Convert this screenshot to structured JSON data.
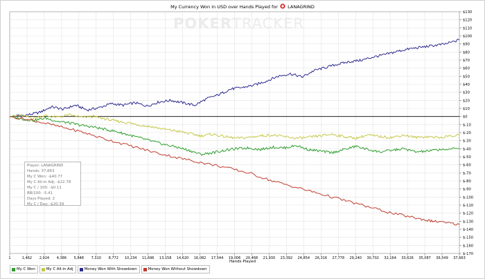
{
  "chart_data": {
    "type": "line",
    "title_prefix": "My Currency Won in USD over Hands Played for",
    "title_player": "LANAGRIND",
    "xlabel": "Hands Played",
    "x_ticks": [
      "1",
      "1,462",
      "2,924",
      "4,386",
      "5,848",
      "7,310",
      "8,772",
      "10,234",
      "11,696",
      "13,158",
      "14,620",
      "16,082",
      "17,544",
      "19,006",
      "20,468",
      "21,930",
      "23,392",
      "24,854",
      "26,316",
      "27,778",
      "29,240",
      "30,702",
      "32,164",
      "33,626",
      "35,087",
      "36,549",
      "37,663"
    ],
    "xlim": [
      1,
      37663
    ],
    "ylim": [
      -170,
      130
    ],
    "y_tick_step": 10,
    "y_tick_labels": [
      "$130",
      "$120",
      "$110",
      "$100",
      "$90",
      "$80",
      "$70",
      "$60",
      "$50",
      "$40",
      "$30",
      "$20",
      "$10",
      "$0",
      "$-10",
      "$-20",
      "$-30",
      "$-40",
      "$-50",
      "$-60",
      "$-70",
      "$-80",
      "$-90",
      "$-100",
      "$-110",
      "$-120",
      "$-130",
      "$-140",
      "$-150",
      "$-160",
      "$-170"
    ],
    "series": [
      {
        "name": "Money Won With Showdown",
        "color": "#2b2b8f",
        "x": [
          1,
          1500,
          2500,
          3500,
          4500,
          5500,
          6500,
          7500,
          8500,
          9500,
          10500,
          11500,
          12500,
          13500,
          14500,
          15500,
          16500,
          17500,
          18500,
          19500,
          20500,
          21500,
          22500,
          23500,
          24500,
          25500,
          26500,
          27500,
          28500,
          29500,
          30500,
          31500,
          32500,
          33500,
          34500,
          35500,
          36500,
          37663
        ],
        "y": [
          0,
          2,
          5,
          12,
          9,
          14,
          8,
          11,
          16,
          14,
          17,
          13,
          18,
          20,
          17,
          14,
          22,
          27,
          34,
          36,
          39,
          44,
          50,
          53,
          49,
          57,
          61,
          65,
          68,
          70,
          74,
          77,
          81,
          84,
          86,
          88,
          90,
          95
        ]
      },
      {
        "name": "My C All-in Adj",
        "color": "#c6c64a",
        "x": [
          1,
          1000,
          2000,
          3000,
          4000,
          5000,
          6000,
          7000,
          8000,
          9000,
          10000,
          11000,
          12000,
          13000,
          14000,
          15000,
          16000,
          17000,
          18000,
          19000,
          20000,
          21000,
          22000,
          23000,
          24000,
          25000,
          26000,
          27000,
          28000,
          29000,
          30000,
          31000,
          32000,
          33000,
          34000,
          35000,
          36000,
          37663
        ],
        "y": [
          0,
          1,
          -2,
          1,
          -1,
          2,
          -1,
          0,
          -3,
          -6,
          -8,
          -11,
          -13,
          -16,
          -18,
          -21,
          -24,
          -22,
          -25,
          -27,
          -26,
          -24,
          -23,
          -25,
          -27,
          -26,
          -24,
          -22,
          -25,
          -27,
          -23,
          -25,
          -26,
          -23,
          -26,
          -25,
          -26,
          -23
        ]
      },
      {
        "name": "My C Won",
        "color": "#2e9e2e",
        "x": [
          1,
          1000,
          2000,
          3000,
          4000,
          5000,
          6000,
          7000,
          8000,
          9000,
          10000,
          11000,
          12000,
          13000,
          14000,
          15000,
          16000,
          17000,
          18000,
          19000,
          20000,
          21000,
          22000,
          23000,
          24000,
          25000,
          26000,
          27000,
          28000,
          29000,
          30000,
          31000,
          32000,
          33000,
          34000,
          35000,
          36000,
          37663
        ],
        "y": [
          0,
          -3,
          -5,
          -2,
          -6,
          -8,
          -11,
          -13,
          -16,
          -19,
          -23,
          -27,
          -31,
          -35,
          -38,
          -42,
          -47,
          -45,
          -42,
          -40,
          -39,
          -41,
          -38,
          -39,
          -36,
          -41,
          -43,
          -45,
          -41,
          -37,
          -41,
          -44,
          -42,
          -40,
          -44,
          -43,
          -41,
          -40
        ]
      },
      {
        "name": "Money Won Without Showdown",
        "color": "#c0392b",
        "x": [
          1,
          2000,
          4000,
          6000,
          8000,
          10000,
          12000,
          14000,
          16000,
          18000,
          20000,
          22000,
          24000,
          26000,
          28000,
          30000,
          32000,
          34000,
          35000,
          36000,
          37663
        ],
        "y": [
          0,
          -5,
          -12,
          -19,
          -28,
          -36,
          -44,
          -51,
          -57,
          -63,
          -70,
          -80,
          -88,
          -96,
          -104,
          -112,
          -120,
          -126,
          -129,
          -131,
          -134
        ]
      }
    ],
    "legend_order": [
      "My C Won",
      "My C All-in Adj",
      "Money Won With Showdown",
      "Money Won Without Showdown"
    ],
    "legend_position": "bottom-left",
    "grid": true
  },
  "watermark": {
    "part1": "POKER",
    "part2": "TRACKER"
  },
  "info_box": [
    "Player: LANAGRIND",
    "Hands: 37,663",
    "My C Won: -$40.77",
    "My C All-in Adj: -$22.78",
    "My C / 100: -$0.11",
    "BB/100: -5.41",
    "Days Played: 2",
    "My C / Day: -$20.39"
  ]
}
